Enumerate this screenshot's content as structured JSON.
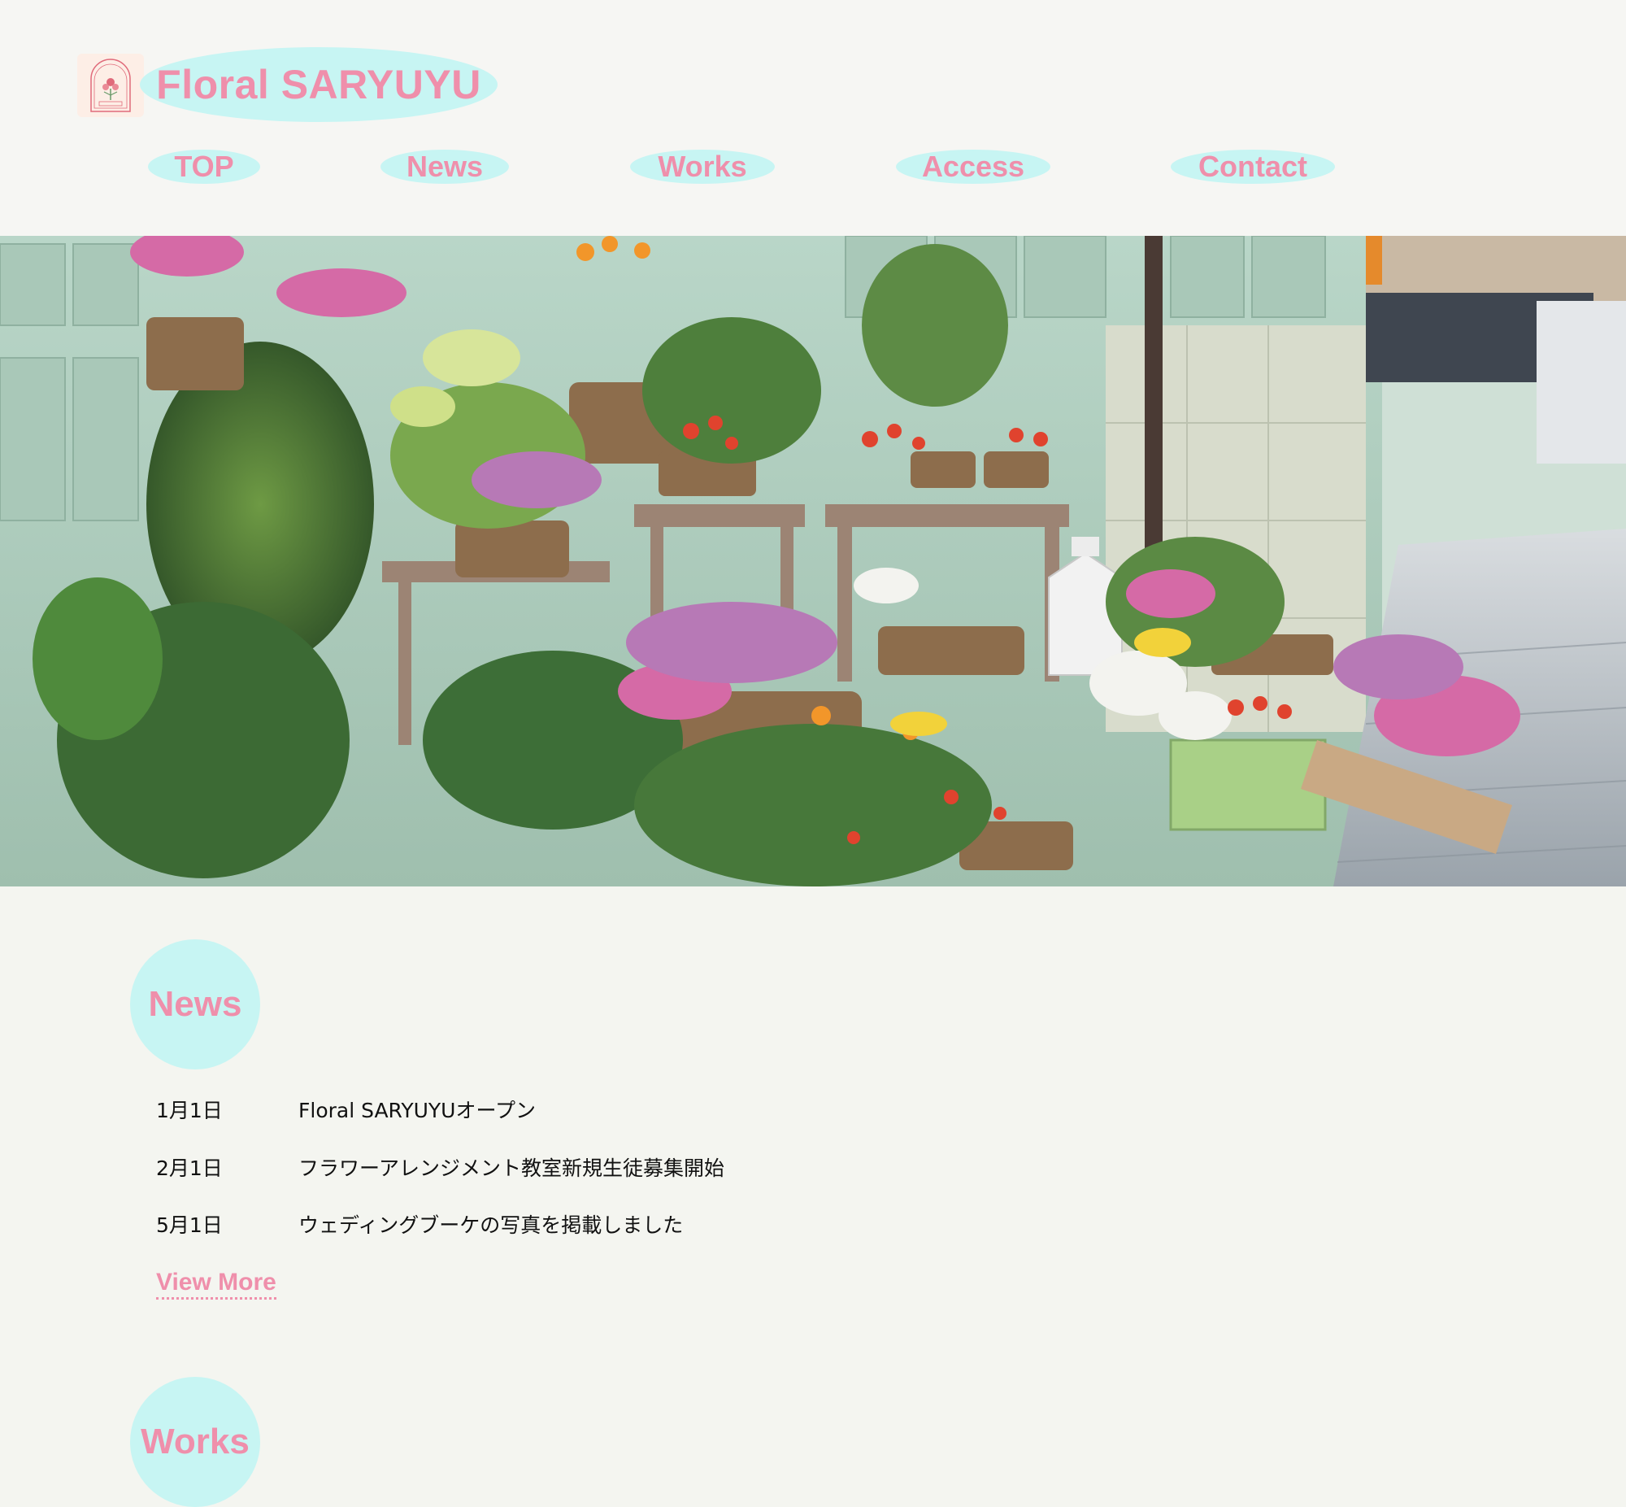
{
  "header": {
    "logo_icon": "floral-crest-logo",
    "title": "Floral SARYUYU"
  },
  "nav": {
    "items": [
      {
        "label": "TOP"
      },
      {
        "label": "News"
      },
      {
        "label": "Works"
      },
      {
        "label": "Access"
      },
      {
        "label": "Contact"
      }
    ]
  },
  "hero": {
    "image_icon": "flower-shop-photo"
  },
  "news": {
    "heading": "News",
    "items": [
      {
        "date": "1月1日",
        "text": "Floral SARYUYUオープン"
      },
      {
        "date": "2月1日",
        "text": "フラワーアレンジメント教室新規生徒募集開始"
      },
      {
        "date": "5月1日",
        "text": "ウェディングブーケの写真を掲載しました"
      }
    ],
    "view_more": "View More"
  },
  "works": {
    "heading": "Works"
  },
  "colors": {
    "accent_pink": "#ef8fab",
    "accent_cyan": "#c7f5f3",
    "page_bg": "#f4f5f0"
  }
}
